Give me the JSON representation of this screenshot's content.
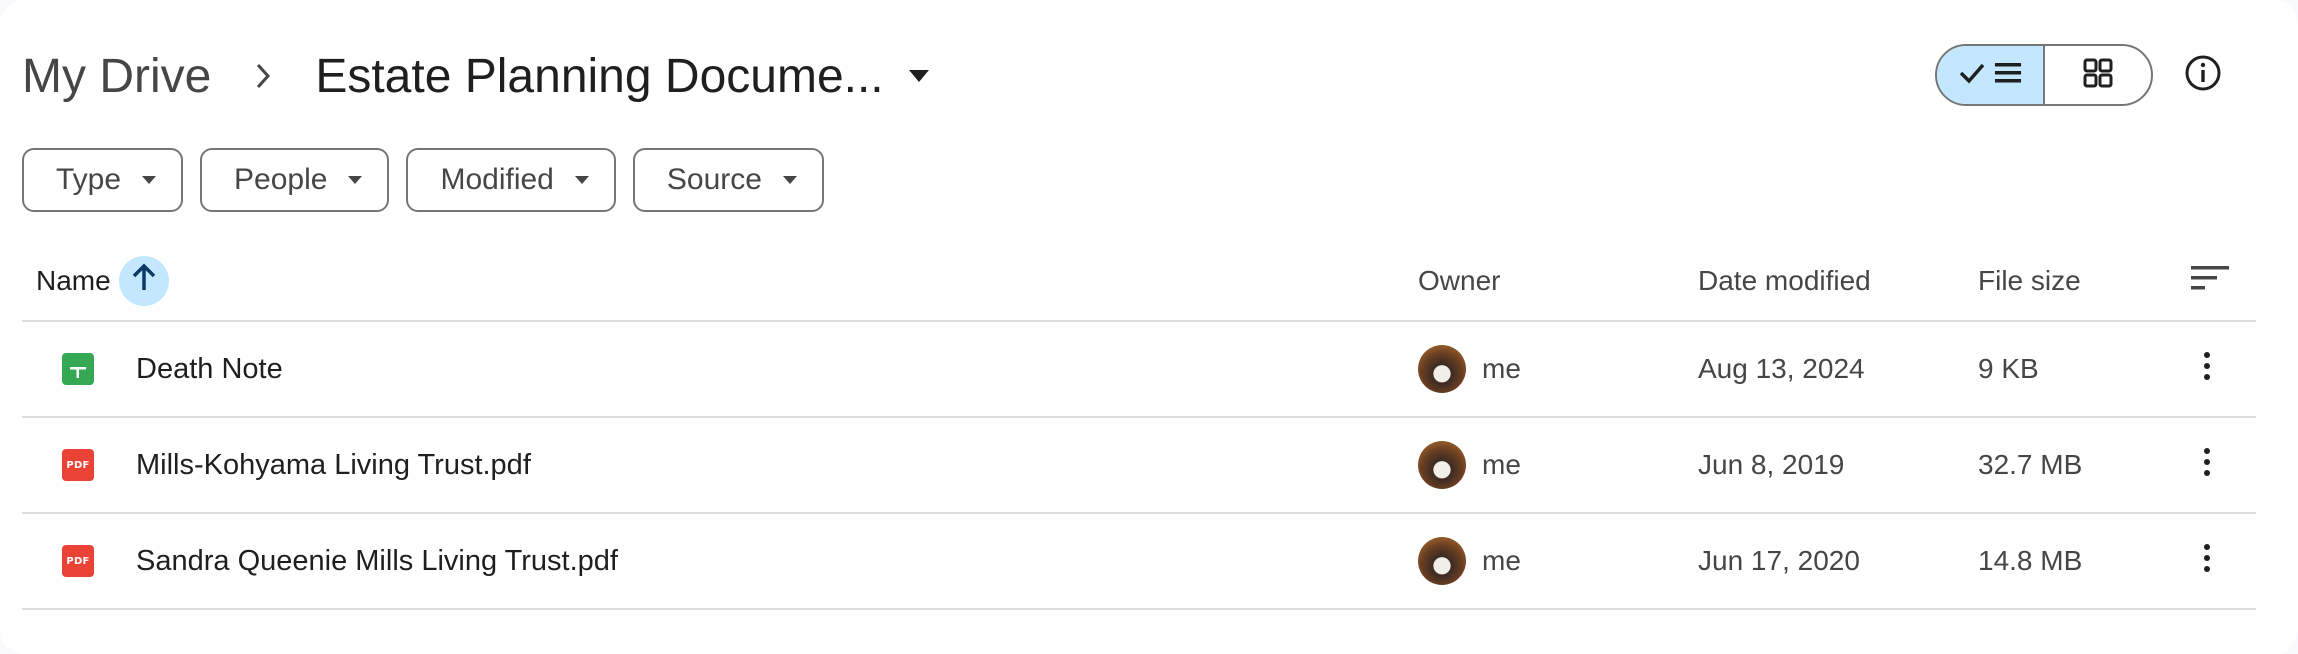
{
  "breadcrumb": {
    "root": "My Drive",
    "current": "Estate Planning Docume..."
  },
  "filters": [
    {
      "label": "Type"
    },
    {
      "label": "People"
    },
    {
      "label": "Modified"
    },
    {
      "label": "Source"
    }
  ],
  "view_toggle": {
    "active": "list",
    "options": [
      "list-view",
      "grid-view"
    ]
  },
  "columns": {
    "name": "Name",
    "owner": "Owner",
    "date_modified": "Date modified",
    "file_size": "File size"
  },
  "sort": {
    "column": "Name",
    "direction": "ascending"
  },
  "files": [
    {
      "name": "Death Note",
      "type": "sheets",
      "owner": "me",
      "date_modified": "Aug 13, 2024",
      "file_size": "9 KB"
    },
    {
      "name": "Mills-Kohyama Living Trust.pdf",
      "type": "pdf",
      "icon_text": "PDF",
      "owner": "me",
      "date_modified": "Jun 8, 2019",
      "file_size": "32.7 MB"
    },
    {
      "name": "Sandra Queenie Mills Living Trust.pdf",
      "type": "pdf",
      "icon_text": "PDF",
      "owner": "me",
      "date_modified": "Jun 17, 2020",
      "file_size": "14.8 MB"
    }
  ],
  "colors": {
    "accent_bg": "#c2e7ff",
    "sheets_green": "#34a853",
    "pdf_red": "#ea4335",
    "text_primary": "#1f1f1f",
    "text_secondary": "#444746"
  }
}
